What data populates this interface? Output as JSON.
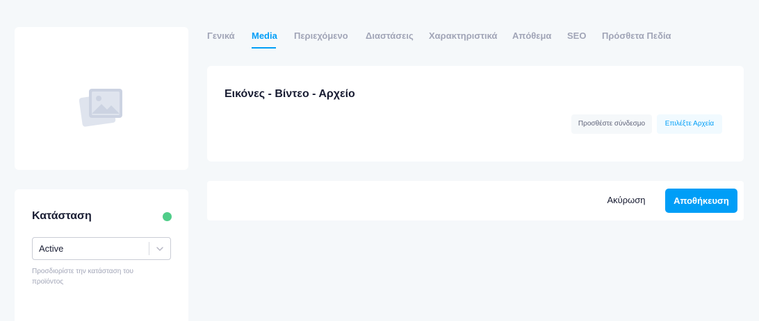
{
  "tabs": [
    {
      "label": "Γενικά",
      "active": false
    },
    {
      "label": "Media",
      "active": true
    },
    {
      "label": "Περιεχόμενο",
      "active": false
    },
    {
      "label": "Διαστάσεις",
      "active": false
    },
    {
      "label": "Χαρακτηριστικά",
      "active": false
    },
    {
      "label": "Απόθεμα",
      "active": false
    },
    {
      "label": "SEO",
      "active": false
    },
    {
      "label": "Πρόσθετα Πεδία",
      "active": false
    }
  ],
  "thumbnail": {
    "icon": "image-placeholder-icon"
  },
  "status": {
    "title": "Κατάσταση",
    "indicator_color": "#50cd89",
    "select_value": "Active",
    "help": "Προσδιορίστε την κατάσταση του προϊόντος"
  },
  "media": {
    "title": "Εικόνες - Βίντεο - Αρχείο",
    "add_link_label": "Προσθέστε σύνδεσμο",
    "choose_files_label": "Επιλέξτε Αρχεία"
  },
  "footer": {
    "cancel_label": "Ακύρωση",
    "save_label": "Αποθήκευση"
  },
  "colors": {
    "accent": "#009ef7",
    "background": "#f5f8fa",
    "muted_text": "#a1a5b7"
  }
}
